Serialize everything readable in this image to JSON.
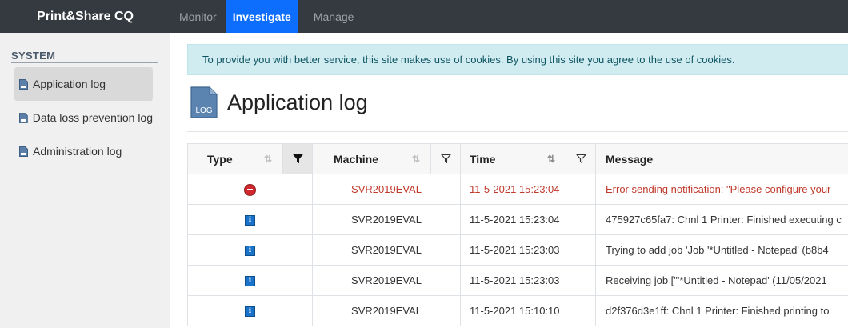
{
  "navbar": {
    "brand": "Print&Share CQ",
    "items": [
      {
        "label": "Monitor",
        "active": false
      },
      {
        "label": "Investigate",
        "active": true
      },
      {
        "label": "Manage",
        "active": false
      }
    ]
  },
  "sidebar": {
    "header": "SYSTEM",
    "items": [
      {
        "label": "Application log",
        "active": true
      },
      {
        "label": "Data loss prevention log",
        "active": false
      },
      {
        "label": "Administration log",
        "active": false
      }
    ]
  },
  "cookie_notice": "To provide you with better service, this site makes use of cookies. By using this site you agree to the use of cookies.",
  "page": {
    "title": "Application log",
    "icon_text": "LOG"
  },
  "table": {
    "columns": [
      {
        "label": "Type",
        "sort_icon": "⇅"
      },
      {
        "label": "Machine",
        "sort_icon": "⇅"
      },
      {
        "label": "Time",
        "sort_icon": "⇅"
      },
      {
        "label": "Message"
      }
    ],
    "rows": [
      {
        "type": "error",
        "machine": "SVR2019EVAL",
        "time": "11-5-2021 15:23:04",
        "message": "Error sending notification: \"Please configure your"
      },
      {
        "type": "info",
        "machine": "SVR2019EVAL",
        "time": "11-5-2021 15:23:04",
        "message": "475927c65fa7: Chnl 1 Printer: Finished executing c"
      },
      {
        "type": "info",
        "machine": "SVR2019EVAL",
        "time": "11-5-2021 15:23:03",
        "message": "Trying to add job 'Job '*Untitled - Notepad' (b8b4"
      },
      {
        "type": "info",
        "machine": "SVR2019EVAL",
        "time": "11-5-2021 15:23:03",
        "message": "Receiving job [\"'*Untitled - Notepad' (11/05/2021"
      },
      {
        "type": "info",
        "machine": "SVR2019EVAL",
        "time": "11-5-2021 15:10:10",
        "message": "d2f376d3e1ff: Chnl 1 Printer: Finished printing to"
      }
    ]
  },
  "icons": {
    "info_glyph": "i"
  },
  "colors": {
    "navbar_bg": "#343a40",
    "nav_active": "#0d6efd",
    "error_text": "#c0392b",
    "cookie_bg": "#d1ecf1"
  }
}
